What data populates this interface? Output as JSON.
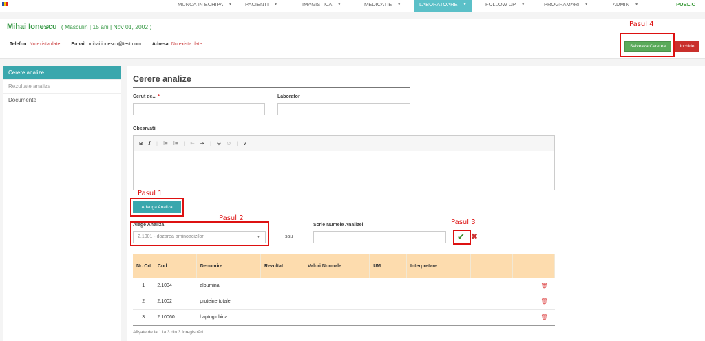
{
  "nav": {
    "items": [
      {
        "label": "MUNCA IN ECHIPA",
        "caret": "▼"
      },
      {
        "label": "PACIENTI",
        "caret": "▼"
      },
      {
        "label": "IMAGISTICA",
        "caret": "▼"
      },
      {
        "label": "MEDICATIE",
        "caret": "▼"
      },
      {
        "label": "LABORATOARE",
        "caret": "▼",
        "active": true
      },
      {
        "label": "FOLLOW UP",
        "caret": "▼"
      },
      {
        "label": "PROGRAMARI",
        "caret": "▼"
      },
      {
        "label": "ADMIN",
        "caret": "▼"
      }
    ],
    "public": "PUBLIC"
  },
  "patient": {
    "name": "Mihai Ionescu",
    "meta": "( Masculin | 15 ani | Nov 01, 2002 )",
    "phone_label": "Telefon:",
    "phone_value": "Nu exista date",
    "email_label": "E-mail:",
    "email_value": "mihai.ionescu@test.com",
    "address_label": "Adresa:",
    "address_value": "Nu exista date"
  },
  "actions": {
    "save": "Salveaza Cererea",
    "close": "Inchide"
  },
  "steps": {
    "s1": "Pasul 1",
    "s2": "Pasul 2",
    "s3": "Pasul 3",
    "s4": "Pasul 4"
  },
  "sidebar": {
    "items": [
      "Cerere analize",
      "Rezultate analize",
      "Documente"
    ]
  },
  "form": {
    "title": "Cerere analize",
    "requested_by_label": "Cerut de...",
    "required_mark": "*",
    "requested_by_value": "",
    "lab_label": "Laborator",
    "lab_value": "",
    "observations_label": "Observatii",
    "toolbar": {
      "bold": "B",
      "italic": "I",
      "ol": "⁝≡",
      "ul": "⁝≡",
      "outdent": "⇤",
      "indent": "⇥",
      "link": "⊖",
      "unlink": "⊘",
      "help": "?"
    },
    "add_button": "Adauga Analiza",
    "choose_label": "Alege Analiza",
    "choose_value": "2.1001 - dozarea aminoacizilor",
    "or": "sau",
    "write_label": "Scrie Numele Analizei",
    "write_value": ""
  },
  "table": {
    "columns": [
      "Nr. Crt",
      "Cod",
      "Denumire",
      "Rezultat",
      "Valori Normale",
      "UM",
      "Interpretare",
      "",
      ""
    ],
    "rows": [
      {
        "nr": "1",
        "cod": "2.1004",
        "denumire": "albumina"
      },
      {
        "nr": "2",
        "cod": "2.1002",
        "denumire": "proteine totale"
      },
      {
        "nr": "3",
        "cod": "2.10060",
        "denumire": "haptoglobina"
      }
    ],
    "footer": "Afișate de la 1 la 3 din 3 înregistrări"
  },
  "colors": {
    "accent": "#3aa7ad",
    "nav_active": "#5bc0c8",
    "patient_name": "#3a9a48",
    "save": "#5aaa5a",
    "close": "#c9302c",
    "table_header": "#fddcae",
    "step_annotation": "#dd1111"
  },
  "icons": {
    "confirm": "checkmark-icon",
    "cancel": "x-icon",
    "delete": "trash-icon",
    "flag": "romania-flag-icon"
  }
}
